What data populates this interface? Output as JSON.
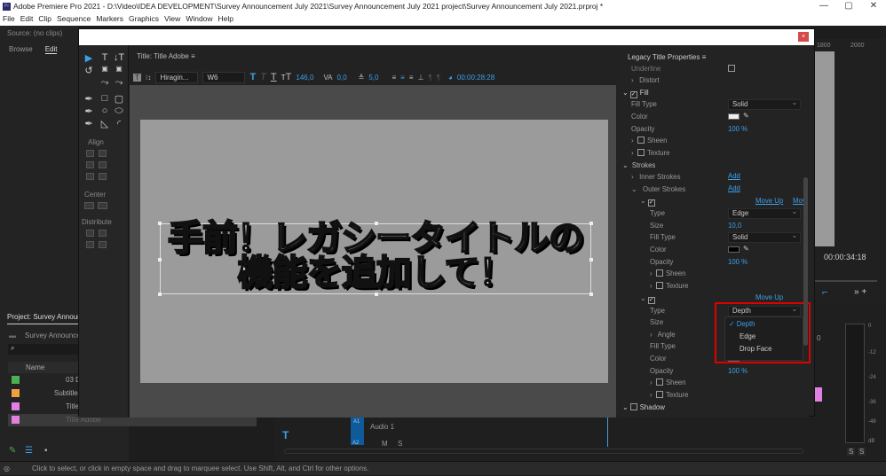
{
  "window": {
    "title": "Adobe Premiere Pro 2021 - D:\\Video\\IDEA DEVELOPMENT\\Survey Announcement July 2021\\Survey Announcement July 2021 project\\Survey Announcement July 2021.prproj *",
    "app_icon": "Pr",
    "minimize": "—",
    "maximize": "▢",
    "close": "✕"
  },
  "menu": [
    "File",
    "Edit",
    "Clip",
    "Sequence",
    "Markers",
    "Graphics",
    "View",
    "Window",
    "Help"
  ],
  "source": {
    "title": "Source: (no clips)",
    "tabs": [
      "Browse",
      "Edit"
    ]
  },
  "dialog": {
    "close": "×"
  },
  "tools": {
    "align": "Align",
    "center": "Center",
    "distribute": "Distribute"
  },
  "title_panel": {
    "title": "Title: Title Adobe ≡",
    "font": "Hiragin...",
    "style": "W6",
    "size": "146,0",
    "kerning": "0,0",
    "leading": "5,0",
    "timecode": "00:00:28:28",
    "text_line1": "手前！レガシータイトルの",
    "text_line2": "機能を追加して！"
  },
  "properties": {
    "title": "Legacy Title Properties ≡",
    "underline": "Underline",
    "distort": "Distort",
    "fill": "Fill",
    "fill_type": "Fill Type",
    "fill_type_value": "Solid",
    "color": "Color",
    "opacity": "Opacity",
    "opacity_value": "100 %",
    "sheen": "Sheen",
    "texture": "Texture",
    "strokes": "Strokes",
    "inner_strokes": "Inner Strokes",
    "outer_strokes": "Outer Strokes",
    "add": "Add",
    "move_up": "Move Up",
    "move_down": "Mov",
    "type": "Type",
    "stroke1_type": "Edge",
    "size": "Size",
    "stroke1_size": "10,0",
    "stroke1_fill_type": "Solid",
    "stroke2_type": "Depth",
    "angle": "Angle",
    "shadow": "Shadow",
    "dropdown_options": [
      "Depth",
      "Edge",
      "Drop Face"
    ],
    "dropdown_selected": "Depth"
  },
  "program": {
    "ruler": [
      "1800",
      "2000"
    ],
    "timecode": "00:00:34:18"
  },
  "project": {
    "title": "Project: Survey Announc",
    "bin": "Survey Announcen",
    "col_name": "Name",
    "items": [
      {
        "name": "03 D",
        "color": "#4caf50"
      },
      {
        "name": "Subtitles",
        "color": "#f0a040"
      },
      {
        "name": "Title",
        "color": "#e080e0"
      },
      {
        "name": "Title Adobe",
        "color": "#e080e0"
      }
    ]
  },
  "timeline": {
    "tracks": [
      "A1",
      "A2"
    ],
    "audio1": "Audio 1",
    "m": "M",
    "s": "S"
  },
  "meters": {
    "scale": [
      "0",
      "-12",
      "-24",
      "-36",
      "-48",
      "dB"
    ],
    "solo": [
      "S",
      "S"
    ],
    "zero": "0"
  },
  "status": "Click to select, or click in empty space and drag to marquee select. Use Shift, Alt, and Ctrl for other options.",
  "colors": {
    "accent": "#3aa0e8",
    "highlight": "#e00000"
  }
}
